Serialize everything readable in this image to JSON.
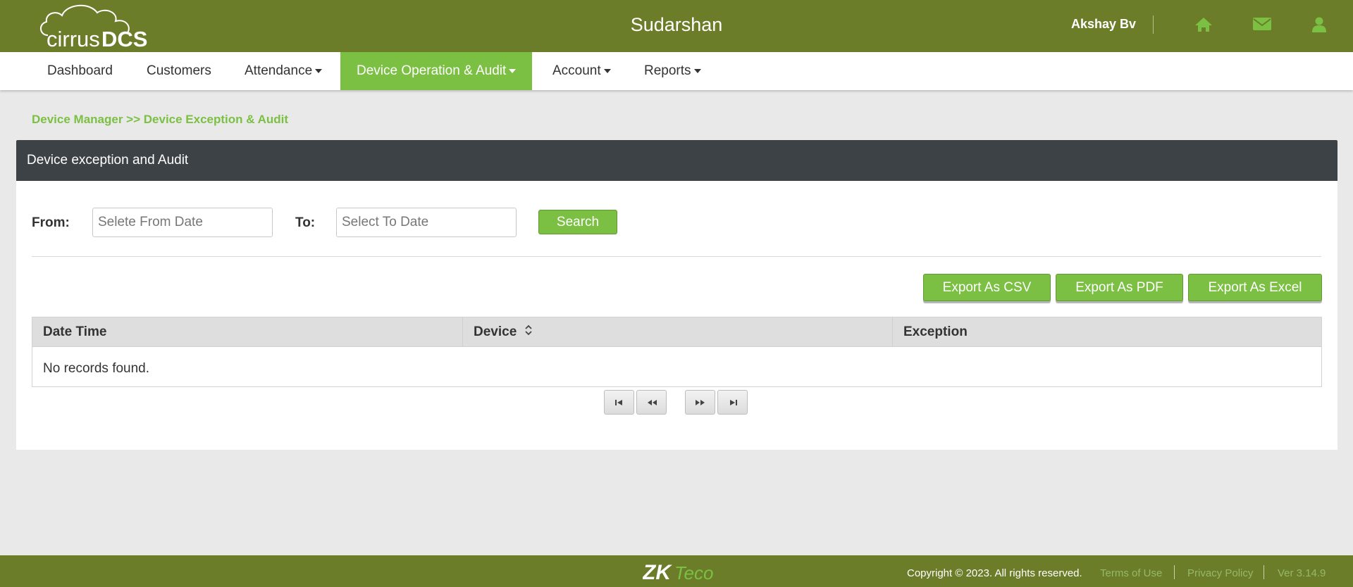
{
  "header": {
    "logo_text_light": "cirrus",
    "logo_text_bold": "DCS",
    "title": "Sudarshan",
    "username": "Akshay Bv",
    "icons": [
      "home-icon",
      "envelope-icon",
      "user-icon"
    ]
  },
  "nav": {
    "items": [
      {
        "label": "Dashboard",
        "dropdown": false
      },
      {
        "label": "Customers",
        "dropdown": false
      },
      {
        "label": "Attendance",
        "dropdown": true
      },
      {
        "label": "Device Operation & Audit",
        "dropdown": true,
        "active": true
      },
      {
        "label": "Account",
        "dropdown": true
      },
      {
        "label": "Reports",
        "dropdown": true
      }
    ]
  },
  "breadcrumb": "Device Manager >> Device Exception & Audit",
  "panel": {
    "title": "Device exception and Audit",
    "filter": {
      "from_label": "From:",
      "from_placeholder": "Selete From Date",
      "from_value": "",
      "to_label": "To:",
      "to_placeholder": "Select To Date",
      "to_value": "",
      "search_label": "Search"
    },
    "export": {
      "csv_label": "Export As CSV",
      "pdf_label": "Export As PDF",
      "excel_label": "Export As Excel"
    },
    "table": {
      "columns": [
        "Date Time",
        "Device",
        "Exception"
      ],
      "sortable_column": "Device",
      "rows": [],
      "empty_message": "No records found."
    },
    "pager": [
      "first-page",
      "prev-page",
      "next-page",
      "last-page"
    ]
  },
  "footer": {
    "brand": "ZKTeco",
    "copyright": "Copyright © 2023. All rights reserved.",
    "terms": "Terms of Use",
    "privacy": "Privacy Policy",
    "version": "Ver 3.14.9"
  },
  "colors": {
    "header_bg": "#6b7d28",
    "accent": "#7bc043",
    "panel_head_bg": "#3d4246",
    "page_bg": "#e9e9e9"
  }
}
